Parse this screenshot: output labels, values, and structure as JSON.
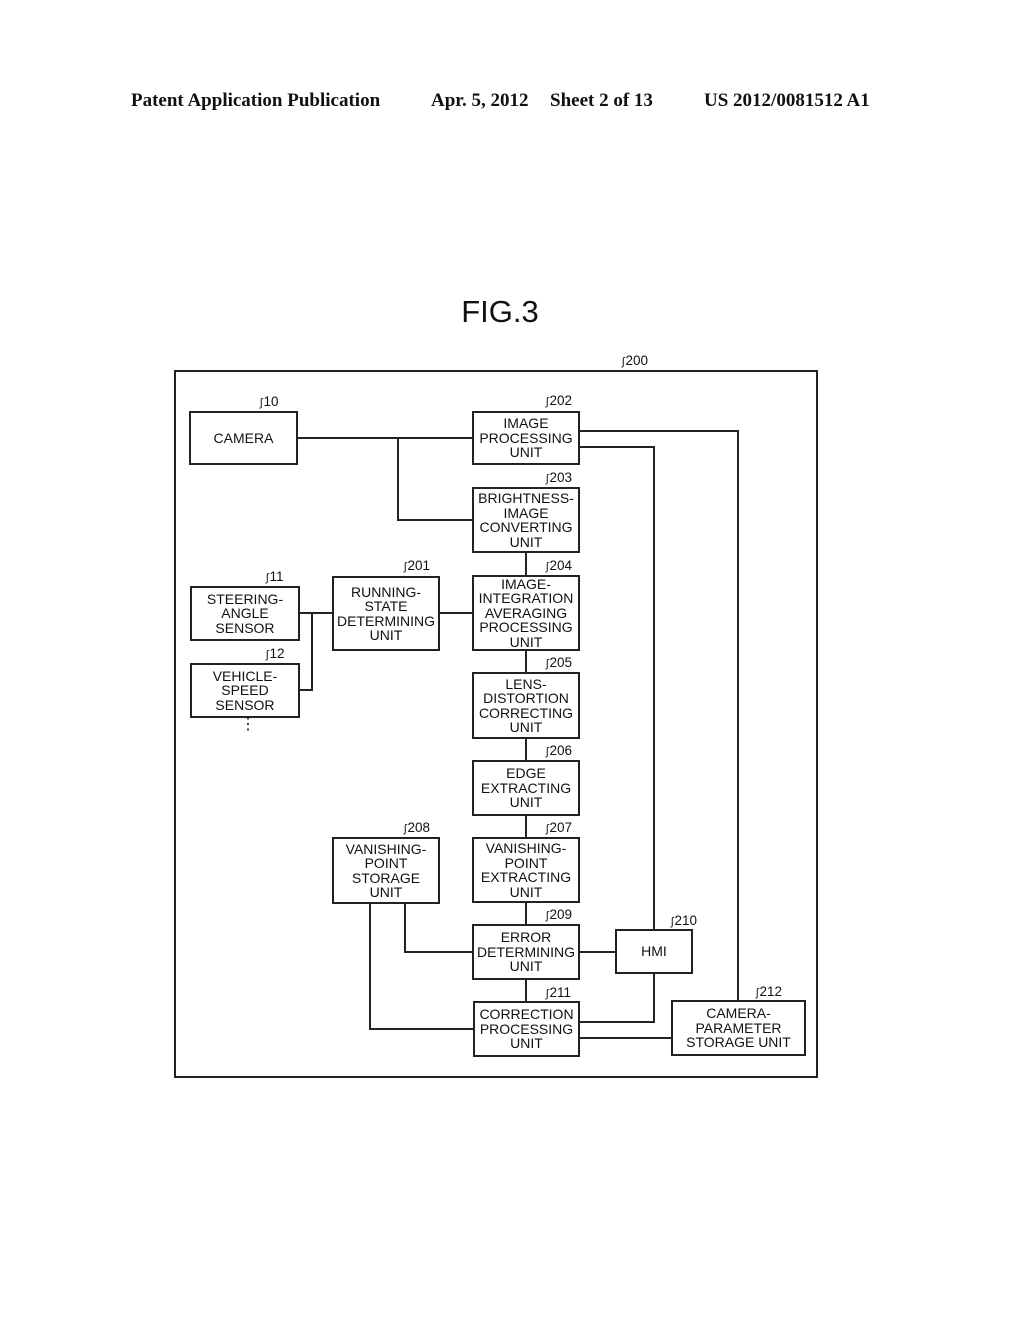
{
  "header": {
    "publication": "Patent Application Publication",
    "date": "Apr. 5, 2012",
    "sheet": "Sheet 2 of 13",
    "number": "US 2012/0081512 A1"
  },
  "figure": {
    "title": "FIG.3",
    "container_ref": "200",
    "blocks": {
      "camera": {
        "ref": "10",
        "label": "CAMERA"
      },
      "steering": {
        "ref": "11",
        "label": "STEERING-\nANGLE\nSENSOR"
      },
      "vehicle_speed": {
        "ref": "12",
        "label": "VEHICLE-\nSPEED\nSENSOR"
      },
      "running_state": {
        "ref": "201",
        "label": "RUNNING-\nSTATE\nDETERMINING\nUNIT"
      },
      "image_processing": {
        "ref": "202",
        "label": "IMAGE\nPROCESSING\nUNIT"
      },
      "brightness": {
        "ref": "203",
        "label": "BRIGHTNESS-\nIMAGE\nCONVERTING\nUNIT"
      },
      "integration": {
        "ref": "204",
        "label": "IMAGE-\nINTEGRATION\nAVERAGING\nPROCESSING\nUNIT"
      },
      "lens": {
        "ref": "205",
        "label": "LENS-\nDISTORTION\nCORRECTING\nUNIT"
      },
      "edge": {
        "ref": "206",
        "label": "EDGE\nEXTRACTING\nUNIT"
      },
      "vp_extract": {
        "ref": "207",
        "label": "VANISHING-\nPOINT\nEXTRACTING\nUNIT"
      },
      "vp_storage": {
        "ref": "208",
        "label": "VANISHING-\nPOINT\nSTORAGE\nUNIT"
      },
      "error": {
        "ref": "209",
        "label": "ERROR\nDETERMINING\nUNIT"
      },
      "hmi": {
        "ref": "210",
        "label": "HMI"
      },
      "correction": {
        "ref": "211",
        "label": "CORRECTION\nPROCESSING\nUNIT"
      },
      "cam_param": {
        "ref": "212",
        "label": "CAMERA-\nPARAMETER\nSTORAGE UNIT"
      }
    },
    "ellipsis": "⋮"
  }
}
